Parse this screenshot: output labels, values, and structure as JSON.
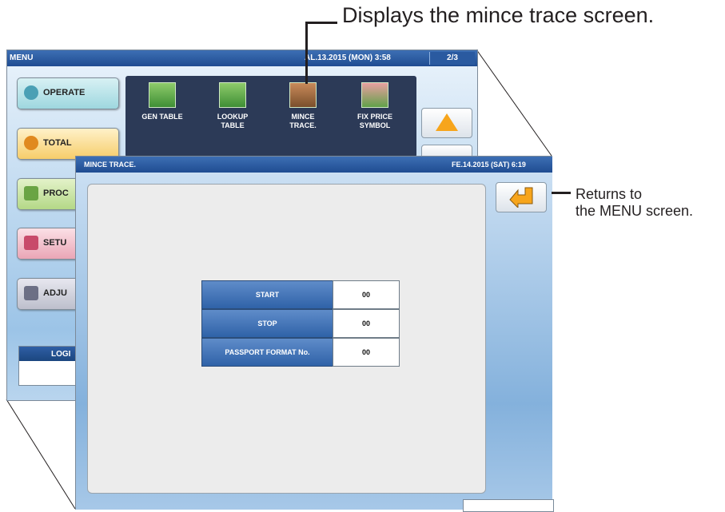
{
  "callouts": {
    "top": "Displays the mince trace screen.",
    "right_line1": "Returns to",
    "right_line2": "the MENU screen."
  },
  "menu_window": {
    "title": "MENU",
    "datetime": "AL.13.2015 (MON)  3:58",
    "page": "2/3",
    "side_buttons": [
      {
        "label": "OPERATE",
        "icon": "play-icon",
        "color": "#9ed7df"
      },
      {
        "label": "TOTAL",
        "icon": "clock-icon",
        "color": "#f6cd6a"
      },
      {
        "label": "PROC",
        "icon": "book-icon",
        "color": "#b4d887"
      },
      {
        "label": "SETU",
        "icon": "wrench-icon",
        "color": "#eaa6b6"
      },
      {
        "label": "ADJU",
        "icon": "adjust-icon",
        "color": "#bdbfcc"
      }
    ],
    "menu_icons": [
      {
        "line1": "GEN TABLE",
        "line2": ""
      },
      {
        "line1": "LOOKUP",
        "line2": "TABLE"
      },
      {
        "line1": "MINCE",
        "line2": "TRACE."
      },
      {
        "line1": "FIX PRICE",
        "line2": "SYMBOL"
      }
    ],
    "login_label": "LOGI"
  },
  "front_window": {
    "title": "MINCE TRACE.",
    "datetime": "FE.14.2015 (SAT)  6:19",
    "rows": [
      {
        "label": "START",
        "value": "00"
      },
      {
        "label": "STOP",
        "value": "00"
      },
      {
        "label": "PASSPORT FORMAT No.",
        "value": "00"
      }
    ]
  },
  "colors": {
    "titlebar": "#1f4c91",
    "accent_arrow": "#f7a51c",
    "row_label": "#2f62a8"
  }
}
